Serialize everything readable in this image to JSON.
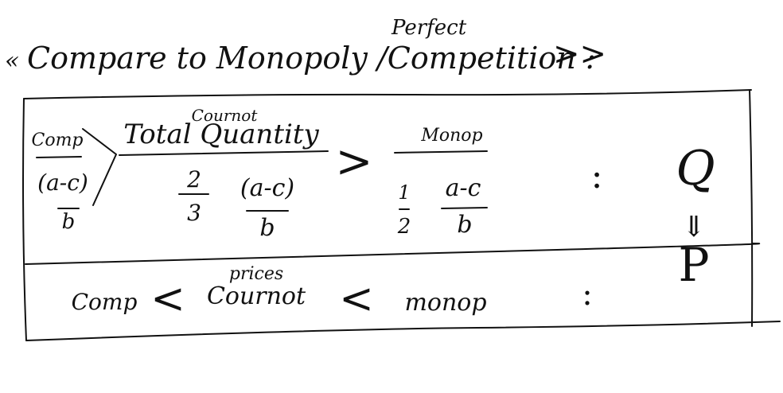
{
  "heading": {
    "open_mark": "«",
    "text": "Compare to Monopoly /Competition :",
    "insert_word": "Perfect",
    "close_mark": ">>"
  },
  "quantity_row": {
    "cournot_caption": "Cournot",
    "total_quantity": "Total Quantity",
    "comp_label": "Comp",
    "comp_numerator": "(a-c)",
    "comp_denominator": "b",
    "cournot_coef_num": "2",
    "cournot_coef_den": "3",
    "cournot_numerator": "(a-c)",
    "cournot_denominator": "b",
    "greater_sign": ">",
    "monop_label": "Monop",
    "monop_coef_num": "1",
    "monop_coef_den": "2",
    "monop_numerator": "a-c",
    "monop_denominator": "b",
    "colon": ":",
    "variable": "Q"
  },
  "arrow": "⇓",
  "price_row": {
    "prices_caption": "prices",
    "comp_label": "Comp",
    "less_sign_1": "<",
    "cournot_label": "Cournot",
    "less_sign_2": "<",
    "monop_label": "monop",
    "colon": ":",
    "variable": "P"
  }
}
